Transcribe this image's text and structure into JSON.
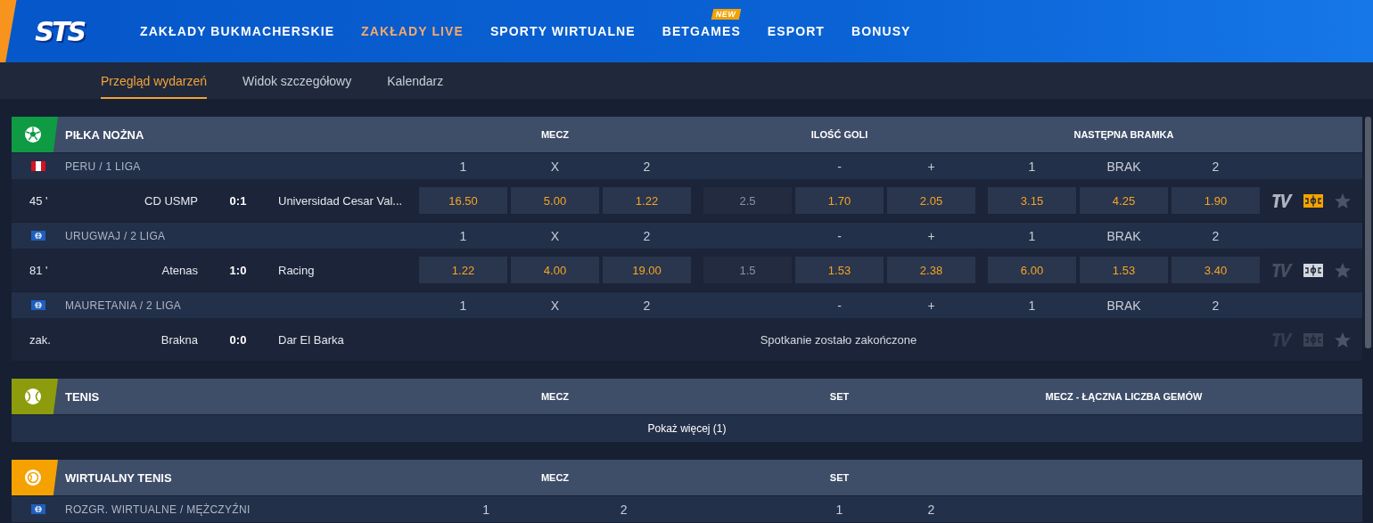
{
  "logo": "STS",
  "nav": [
    {
      "label": "ZAKŁADY BUKMACHERSKIE",
      "selected": false
    },
    {
      "label": "ZAKŁADY LIVE",
      "selected": true
    },
    {
      "label": "SPORTY WIRTUALNE",
      "selected": false
    },
    {
      "label": "BETGAMES",
      "selected": false,
      "badge": "NEW"
    },
    {
      "label": "ESPORT",
      "selected": false
    },
    {
      "label": "BONUSY",
      "selected": false
    }
  ],
  "subtabs": [
    {
      "label": "Przegląd wydarzeń",
      "selected": true
    },
    {
      "label": "Widok szczegółowy",
      "selected": false
    },
    {
      "label": "Kalendarz",
      "selected": false
    }
  ],
  "sports": [
    {
      "name": "PIŁKA NOŻNA",
      "kind": "football",
      "color": "#0f9a44",
      "markets": [
        {
          "title": "MECZ",
          "kind": "plain"
        },
        {
          "title": "ILOŚĆ GOLI",
          "kind": "line"
        },
        {
          "title": "NASTĘPNA BRAMKA",
          "kind": "plain"
        }
      ],
      "leagues": [
        {
          "name": "PERU / 1 LIGA",
          "kind": "peru",
          "labels": [
            [
              "1",
              "X",
              "2"
            ],
            [
              "-",
              "+"
            ],
            [
              "1",
              "BRAK",
              "2"
            ]
          ],
          "events": [
            {
              "time": "45 '",
              "home": "CD USMP",
              "score": "0:1",
              "away": "Universidad Cesar Val...",
              "markets": [
                {
                  "odds": [
                    "16.50",
                    "5.00",
                    "1.22"
                  ]
                },
                {
                  "line": "2.5",
                  "odds": [
                    "1.70",
                    "2.05"
                  ]
                },
                {
                  "odds": [
                    "3.15",
                    "4.25",
                    "1.90"
                  ]
                }
              ],
              "tv": true,
              "tracker_on": true,
              "disabled": false
            }
          ]
        },
        {
          "name": "URUGWAJ / 2 LIGA",
          "kind": "world",
          "labels": [
            [
              "1",
              "X",
              "2"
            ],
            [
              "-",
              "+"
            ],
            [
              "1",
              "BRAK",
              "2"
            ]
          ],
          "events": [
            {
              "time": "81 '",
              "home": "Atenas",
              "score": "1:0",
              "away": "Racing",
              "markets": [
                {
                  "odds": [
                    "1.22",
                    "4.00",
                    "19.00"
                  ]
                },
                {
                  "line": "1.5",
                  "odds": [
                    "1.53",
                    "2.38"
                  ]
                },
                {
                  "odds": [
                    "6.00",
                    "1.53",
                    "3.40"
                  ]
                }
              ],
              "tv": false,
              "tracker_on": false,
              "disabled": false
            }
          ]
        },
        {
          "name": "MAURETANIA / 2 LIGA",
          "kind": "world",
          "labels": [
            [
              "1",
              "X",
              "2"
            ],
            [
              "-",
              "+"
            ],
            [
              "1",
              "BRAK",
              "2"
            ]
          ],
          "events": [
            {
              "time": "zak.",
              "home": "Brakna",
              "score": "0:0",
              "away": "Dar El Barka",
              "status": "Spotkanie zostało zakończone",
              "tv": false,
              "tracker_on": false,
              "disabled": true
            }
          ]
        }
      ]
    },
    {
      "name": "TENIS",
      "kind": "tennis",
      "color": "#8c9c0c",
      "markets": [
        {
          "title": "MECZ"
        },
        {
          "title": "SET"
        },
        {
          "title": "MECZ - ŁĄCZNA LICZBA GEMÓW"
        }
      ],
      "show_more": "Pokaż więcej (1)"
    },
    {
      "name": "WIRTUALNY TENIS",
      "kind": "virtual-tennis",
      "color": "#f5a200",
      "markets": [
        {
          "title": "MECZ",
          "kind": "plain"
        },
        {
          "title": "SET",
          "kind": "line"
        }
      ],
      "leagues": [
        {
          "name": "ROZGR. WIRTUALNE / MĘŻCZYŹNI",
          "kind": "world",
          "labels": [
            [
              "1",
              "2"
            ],
            [
              "1",
              "2"
            ]
          ]
        }
      ]
    }
  ]
}
